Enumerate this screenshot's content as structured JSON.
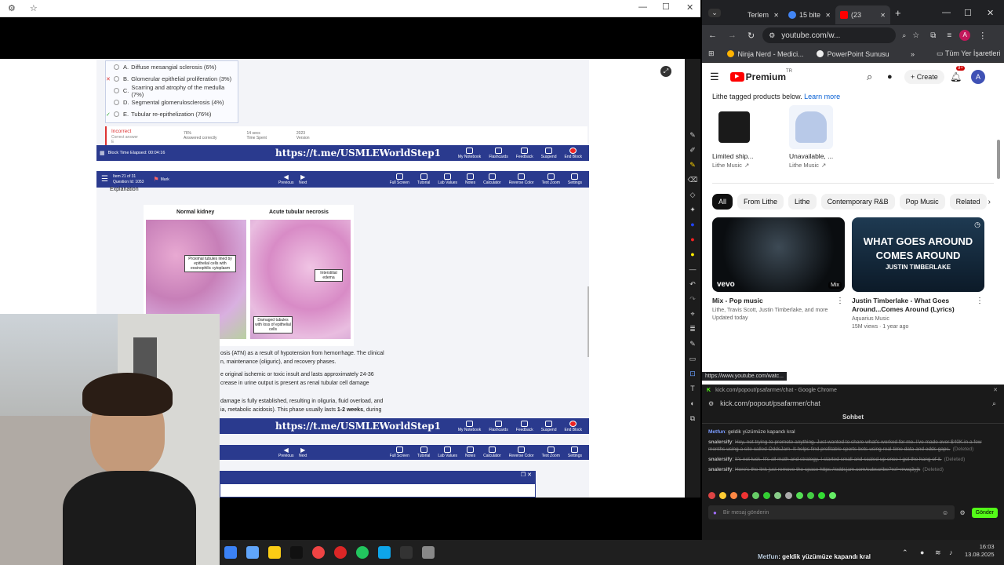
{
  "left_window": {
    "titlebar_icons": [
      "gear-icon",
      "star-icon"
    ]
  },
  "question": {
    "options": [
      {
        "letter": "A.",
        "text": "Diffuse mesangial sclerosis (6%)",
        "mark": ""
      },
      {
        "letter": "B.",
        "text": "Glomerular epithelial proliferation (3%)",
        "mark": "✕"
      },
      {
        "letter": "C.",
        "text": "Scarring and atrophy of the medulla (7%)",
        "mark": ""
      },
      {
        "letter": "D.",
        "text": "Segmental glomerulosclerosis (4%)",
        "mark": ""
      },
      {
        "letter": "E.",
        "text": "Tubular re-epithelization (76%)",
        "mark": "✓"
      }
    ],
    "result": "Incorrect",
    "result_sub": "Correct answer",
    "result_letter": "E",
    "stats": [
      {
        "value": "76%",
        "label": "Answered correctly"
      },
      {
        "value": "14 secs",
        "label": "Time Spent"
      },
      {
        "value": "2023",
        "label": "Version"
      }
    ]
  },
  "banner": {
    "timer": "Block Time Elapsed: 00:04:16",
    "url": "https://t.me/USMLEWorldStep1",
    "buttons": [
      "My Notebook",
      "Flashcards",
      "Feedback",
      "Suspend",
      "End Block"
    ]
  },
  "nav": {
    "item": "Item 21 of 31",
    "qid": "Question Id: 1053",
    "mark": "Mark",
    "prev": "Previous",
    "next": "Next",
    "tools": [
      "Full Screen",
      "Tutorial",
      "Lab Values",
      "Notes",
      "Calculator",
      "Reverse Color",
      "Text Zoom",
      "Settings"
    ]
  },
  "explanation": {
    "heading": "Explanation",
    "img1_title": "Normal kidney",
    "img2_title": "Acute tubular necrosis",
    "label1": "Proximal tubules lined by epithelial cells with eosinophilic cytoplasm",
    "label2": "Interstitial edema",
    "label3": "Damaged tubules with loss of epithelial cells",
    "p1": "osis (ATN) as a result of hypotension from hemorrhage. The clinical",
    "p2": "n, maintenance (oliguric), and recovery phases.",
    "p3": "e original ischemic or toxic insult and lasts approximately 24-36",
    "p4": "crease in urine output is present as renal tubular cell damage",
    "p5": "damage is fully established, resulting in oliguria, fluid overload, and",
    "p6": "ia, metabolic acidosis). This phase usually lasts ",
    "p6b": "1-2 weeks",
    "p6c": ", during"
  },
  "chrome": {
    "tabs": [
      {
        "label": "Terlem"
      },
      {
        "label": "15 bite"
      },
      {
        "label": "(23"
      }
    ],
    "url": "youtube.com/w...",
    "bookmarks": [
      "Ninja Nerd - Medici...",
      "PowerPoint Sunusu"
    ],
    "all_bookmarks": "Tüm Yer İşaretleri",
    "avatar": "A"
  },
  "youtube": {
    "logo": "Premium",
    "logo_sup": "TR",
    "create": "Create",
    "notif": "9+",
    "avatar": "A",
    "tagged": "Lithe tagged products below.",
    "learn_more": "Learn more",
    "products": [
      {
        "name": "Limited ship...",
        "seller": "Lithe Music"
      },
      {
        "name": "Unavailable, ...",
        "seller": "Lithe Music"
      }
    ],
    "chips": [
      "All",
      "From Lithe",
      "Lithe",
      "Contemporary R&B",
      "Pop Music",
      "Related"
    ],
    "videos": [
      {
        "title": "Mix - Pop music",
        "meta1": "Lithe, Travis Scott, Justin Timberlake, and more",
        "meta2": "Updated today",
        "badge": "Mix",
        "brand": "vevo"
      },
      {
        "title": "Justin Timberlake - What Goes Around...Comes Around (Lyrics)",
        "meta1": "Aquarius Music",
        "meta2": "15M views · 1 year ago",
        "thumb1": "WHAT GOES AROUND",
        "thumb2": "COMES AROUND",
        "thumb3": "JUSTIN TIMBERLAKE"
      }
    ],
    "status_url": "https://www.youtube.com/watc..."
  },
  "kick": {
    "title": "kick.com/popout/psafarmer/chat - Google Chrome",
    "url": "kick.com/popout/psafarmer/chat",
    "header": "Sohbet",
    "messages": [
      {
        "user": "Metfun",
        "text": "geldik yüzümüze kapandı kral",
        "deleted": false
      },
      {
        "user": "snalersify",
        "text": "Hey, not trying to promote anything. Just wanted to share what's worked for me. I've made over $40K in a few months using a site called OddsJam. It helps find profitable sports bets using real-time data and odds gaps.",
        "deleted": true
      },
      {
        "user": "snalersify",
        "text": "It's not luck. It's all math and strategy. I started small and scaled up once I got the hang of it.",
        "deleted": true
      },
      {
        "user": "snalersify",
        "text": "Here's the link just remove the space https://oddsjam.com/subscribe?ref=mwq3yjk",
        "deleted": true
      }
    ],
    "deleted_tag": "(Deleted)",
    "placeholder": "Bir mesaj gönderin",
    "send": "Gönder"
  },
  "taskbar": {
    "time": "16:03",
    "date": "13.08.2025",
    "ticker_user": "Metfun",
    "ticker_text": ": geldik yüzümüze kapandı kral"
  },
  "colors": {
    "uworld_blue": "#2a3a8e",
    "youtube_red": "#ff0000",
    "kick_green": "#53fc18"
  }
}
